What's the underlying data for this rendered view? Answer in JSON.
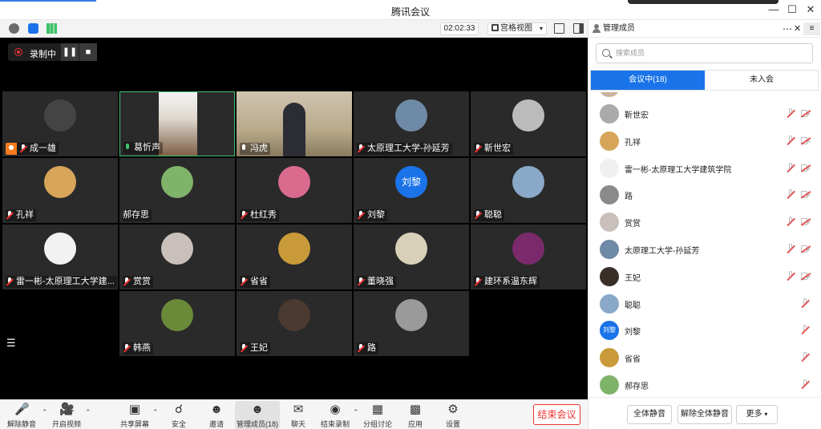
{
  "window": {
    "title": "腾讯会议",
    "controls": [
      "minimize",
      "maximize",
      "close"
    ]
  },
  "meeting_toolbar": {
    "timer": "02:02:33",
    "view_mode": "宫格视图"
  },
  "recording": {
    "label": "录制中"
  },
  "tiles": [
    {
      "name": "成一雄",
      "host": true,
      "mic": "muted",
      "avatar_color": "#444444"
    },
    {
      "name": "葛忻声",
      "mic": "on",
      "video": true,
      "avatar_color": "#7a5a40",
      "active": true
    },
    {
      "name": "冯虎",
      "mic": "on-white",
      "video": true,
      "avatar_color": "#b9a98a"
    },
    {
      "name": "太原理工大学-孙延芳",
      "mic": "muted",
      "avatar_color": "#6f8aa6"
    },
    {
      "name": "靳世宏",
      "mic": "muted",
      "avatar_color": "#bbbbbb"
    },
    {
      "name": "孔祥",
      "mic": "muted",
      "avatar_color": "#d6a55a"
    },
    {
      "name": "郝存思",
      "mic": "none",
      "avatar_color": "#7fb36a"
    },
    {
      "name": "杜红秀",
      "mic": "muted",
      "avatar_color": "#d96a8e"
    },
    {
      "name": "刘黎",
      "mic": "muted",
      "avatar_color": "#1a73e8",
      "avatar_text": "刘黎"
    },
    {
      "name": "聪聪",
      "mic": "muted",
      "avatar_color": "#8aa9c8"
    },
    {
      "name": "雷一彬-太原理工大学建...",
      "mic": "muted",
      "avatar_color": "#f2f2f2"
    },
    {
      "name": "赏赏",
      "mic": "muted",
      "avatar_color": "#c9c0bb"
    },
    {
      "name": "省省",
      "mic": "muted",
      "avatar_color": "#c99a3a"
    },
    {
      "name": "董晓强",
      "mic": "muted",
      "avatar_color": "#d8d0b8"
    },
    {
      "name": "建环系温东辉",
      "mic": "muted",
      "avatar_color": "#7a2a6a"
    },
    {
      "name": "韩燕",
      "mic": "muted",
      "avatar_color": "#6a8a3a"
    },
    {
      "name": "王妃",
      "mic": "muted",
      "avatar_color": "#4a3a30"
    },
    {
      "name": "路",
      "mic": "muted",
      "avatar_color": "#9a9a9a"
    }
  ],
  "controls_bar": [
    {
      "label": "解除静音",
      "icon": "mic-off-icon"
    },
    {
      "label": "开启视频",
      "icon": "camera-off-icon"
    },
    {
      "label": "共享屏幕",
      "icon": "share-screen-icon"
    },
    {
      "label": "安全",
      "icon": "shield-icon"
    },
    {
      "label": "邀请",
      "icon": "invite-icon"
    },
    {
      "label": "管理成员(18)",
      "icon": "members-icon"
    },
    {
      "label": "聊天",
      "icon": "chat-icon"
    },
    {
      "label": "结束录制",
      "icon": "stop-record-icon"
    },
    {
      "label": "分组讨论",
      "icon": "breakout-icon"
    },
    {
      "label": "应用",
      "icon": "apps-icon"
    },
    {
      "label": "设置",
      "icon": "gear-icon"
    }
  ],
  "end_button": "结束会议",
  "panel": {
    "title": "管理成员",
    "search_placeholder": "搜索成员",
    "tab_in_meeting": "会议中(18)",
    "tab_not_joined": "未入会",
    "members": [
      {
        "name": "靳世宏",
        "cam": true,
        "avatar_color": "#aaaaaa"
      },
      {
        "name": "孔祥",
        "cam": true,
        "avatar_color": "#d6a55a"
      },
      {
        "name": "雷一彬-太原理工大学建筑学院",
        "cam": true,
        "avatar_color": "#f0f0f0"
      },
      {
        "name": "路",
        "cam": true,
        "avatar_color": "#8a8a8a"
      },
      {
        "name": "赏赏",
        "cam": true,
        "avatar_color": "#c9c0bb"
      },
      {
        "name": "太原理工大学-孙延芳",
        "cam": true,
        "avatar_color": "#6f8aa6"
      },
      {
        "name": "王妃",
        "cam": true,
        "avatar_color": "#3a2e28"
      },
      {
        "name": "聪聪",
        "cam": false,
        "avatar_color": "#8aa9c8"
      },
      {
        "name": "刘黎",
        "cam": false,
        "avatar_color": "#1a73e8",
        "avatar_text": "刘黎"
      },
      {
        "name": "省省",
        "cam": false,
        "avatar_color": "#c99a3a"
      },
      {
        "name": "郝存思",
        "cam": false,
        "avatar_color": "#7fb36a"
      }
    ],
    "mute_all": "全体静音",
    "unmute_all": "解除全体静音",
    "more": "更多"
  },
  "colors": {
    "accent": "#1a73e8",
    "danger": "#e33333",
    "active_border": "#3bc26a"
  }
}
